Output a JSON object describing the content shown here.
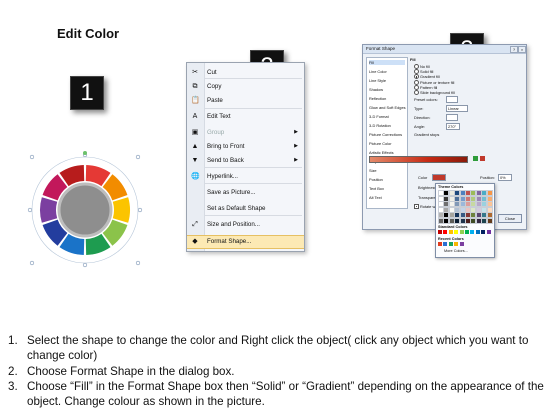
{
  "page": {
    "title": "Edit Color"
  },
  "badges": [
    "1",
    "2",
    "3"
  ],
  "wheel": {
    "segment_colors": [
      "#e53935",
      "#f28c00",
      "#fbc400",
      "#8bc34a",
      "#1e9c50",
      "#1a73c8",
      "#233d9e",
      "#7b3fa0",
      "#c2185b",
      "#b71c1c"
    ],
    "center_color": "#8e8e8e"
  },
  "context_menu": {
    "items": [
      {
        "icon": "cut-icon",
        "glyph": "✂",
        "label": "Cut",
        "disabled": false
      },
      {
        "icon": "copy-icon",
        "glyph": "⧉",
        "label": "Copy",
        "disabled": false
      },
      {
        "icon": "paste-icon",
        "glyph": "📋",
        "label": "Paste",
        "disabled": false
      },
      {
        "icon": "edit-text-icon",
        "glyph": "A",
        "label": "Edit Text",
        "disabled": false
      },
      {
        "icon": "group-icon",
        "glyph": "▣",
        "label": "Group",
        "disabled": true,
        "submenu": true
      },
      {
        "icon": "bring-to-front-icon",
        "glyph": "▲",
        "label": "Bring to Front",
        "disabled": false,
        "submenu": true
      },
      {
        "icon": "send-to-back-icon",
        "glyph": "▼",
        "label": "Send to Back",
        "disabled": false,
        "submenu": true
      },
      {
        "icon": "hyperlink-icon",
        "glyph": "🌐",
        "label": "Hyperlink...",
        "disabled": false
      },
      {
        "icon": "none",
        "glyph": "",
        "label": "Save as Picture...",
        "disabled": false
      },
      {
        "icon": "none",
        "glyph": "",
        "label": "Set as Default Shape",
        "disabled": false
      },
      {
        "icon": "size-position-icon",
        "glyph": "⤢",
        "label": "Size and Position...",
        "disabled": false
      },
      {
        "icon": "format-shape-icon",
        "glyph": "◆",
        "label": "Format Shape...",
        "disabled": false,
        "highlighted": true
      }
    ]
  },
  "format_shape": {
    "title": "Format Shape",
    "nav": [
      "Fill",
      "Line Color",
      "Line Style",
      "Shadow",
      "Reflection",
      "Glow and Soft Edges",
      "3-D Format",
      "3-D Rotation",
      "Picture Corrections",
      "Picture Color",
      "Artistic Effects",
      "Crop",
      "Size",
      "Position",
      "Text Box",
      "Alt Text"
    ],
    "section_label": "Fill",
    "fill_options": [
      {
        "label": "No fill",
        "selected": false
      },
      {
        "label": "Solid fill",
        "selected": false
      },
      {
        "label": "Gradient fill",
        "selected": true
      },
      {
        "label": "Picture or texture fill",
        "selected": false
      },
      {
        "label": "Pattern fill",
        "selected": false
      },
      {
        "label": "Slide background fill",
        "selected": false
      }
    ],
    "preset_colors_label": "Preset colors:",
    "type_label": "Type:",
    "type_value": "Linear",
    "direction_label": "Direction:",
    "angle_label": "Angle:",
    "angle_value": "270°",
    "gradient_stops_label": "Gradient stops",
    "color_label": "Color",
    "position_label": "Position:",
    "position_value": "0%",
    "brightness_label": "Brightness:",
    "transparency_label": "Transparency:",
    "rotate_label": "Rotate with shape",
    "theme_colors_label": "Theme Colors",
    "standard_colors_label": "Standard Colors",
    "recent_colors_label": "Recent Colors",
    "more_colors_label": "More Colors...",
    "close_label": "Close",
    "theme_swatches": [
      "#ffffff",
      "#000000",
      "#eeece1",
      "#1f497d",
      "#4f81bd",
      "#c0504d",
      "#9bbb59",
      "#8064a2",
      "#4bacc6",
      "#f79646"
    ],
    "standard_swatches": [
      "#c00000",
      "#ff0000",
      "#ffc000",
      "#ffff00",
      "#92d050",
      "#00b050",
      "#00b0f0",
      "#0070c0",
      "#002060",
      "#7030a0"
    ],
    "recent_swatches": [
      "#e03c1e",
      "#2a6fd1",
      "#19a35a",
      "#f7b500",
      "#7b3fa0"
    ]
  },
  "instructions": [
    {
      "num": "1.",
      "text": "Select the shape to change the color and Right click the object( click any object which you want to change color)"
    },
    {
      "num": "2.",
      "text": "Choose Format Shape in the dialog box."
    },
    {
      "num": "3.",
      "text": "Choose “Fill” in the Format Shape box then “Solid” or “Gradient” depending on the appearance of the object. Change colour as shown in the picture."
    }
  ]
}
